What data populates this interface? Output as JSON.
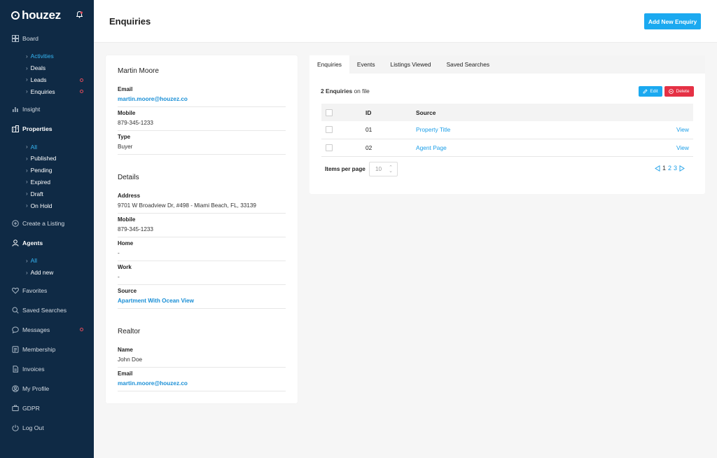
{
  "sidebar": {
    "logo_text": "houzez",
    "nav": {
      "board": "Board",
      "board_sub": [
        "Activities",
        "Deals",
        "Leads",
        "Enquiries"
      ],
      "insight": "Insight",
      "properties": "Properties",
      "properties_sub": [
        "All",
        "Published",
        "Pending",
        "Expired",
        "Draft",
        "On Hold"
      ],
      "create_listing": "Create a Listing",
      "agents": "Agents",
      "agents_sub": [
        "All",
        "Add new"
      ],
      "favorites": "Favorites",
      "saved_searches": "Saved Searches",
      "messages": "Messages",
      "membership": "Membership",
      "invoices": "Invoices",
      "my_profile": "My Profile",
      "gdpr": "GDPR",
      "log_out": "Log Out"
    }
  },
  "header": {
    "title": "Enquiries",
    "add_button": "Add New Enquiry"
  },
  "contact": {
    "name": "Martin Moore",
    "email_label": "Email",
    "email": "martin.moore@houzez.co",
    "mobile_label": "Mobile",
    "mobile": "879-345-1233",
    "type_label": "Type",
    "type": "Buyer"
  },
  "details": {
    "title": "Details",
    "address_label": "Address",
    "address": "9701 W Broadview Dr, #498 - Miami Beach, FL, 33139",
    "mobile_label": "Mobile",
    "mobile": "879-345-1233",
    "home_label": "Home",
    "home": "-",
    "work_label": "Work",
    "work": "-",
    "source_label": "Source",
    "source": "Apartment With Ocean View"
  },
  "realtor": {
    "title": "Realtor",
    "name_label": "Name",
    "name": "John Doe",
    "email_label": "Email",
    "email": "martin.moore@houzez.co"
  },
  "tabs": [
    "Enquiries",
    "Events",
    "Listings Viewed",
    "Saved Searches"
  ],
  "enquiries": {
    "count_bold": "2 Enquiries",
    "count_rest": " on file",
    "edit_label": "Edit",
    "delete_label": "Delete",
    "columns": {
      "id": "ID",
      "source": "Source"
    },
    "rows": [
      {
        "id": "01",
        "source": "Property Title",
        "action": "View"
      },
      {
        "id": "02",
        "source": "Agent Page",
        "action": "View"
      }
    ],
    "items_per_page_label": "Items per page",
    "items_per_page": "10",
    "pages": [
      "1",
      "2",
      "3"
    ]
  },
  "colors": {
    "sidebar_bg": "#0f2a45",
    "accent": "#1ba9f0",
    "danger": "#e53145",
    "active_link": "#35b5f3"
  }
}
